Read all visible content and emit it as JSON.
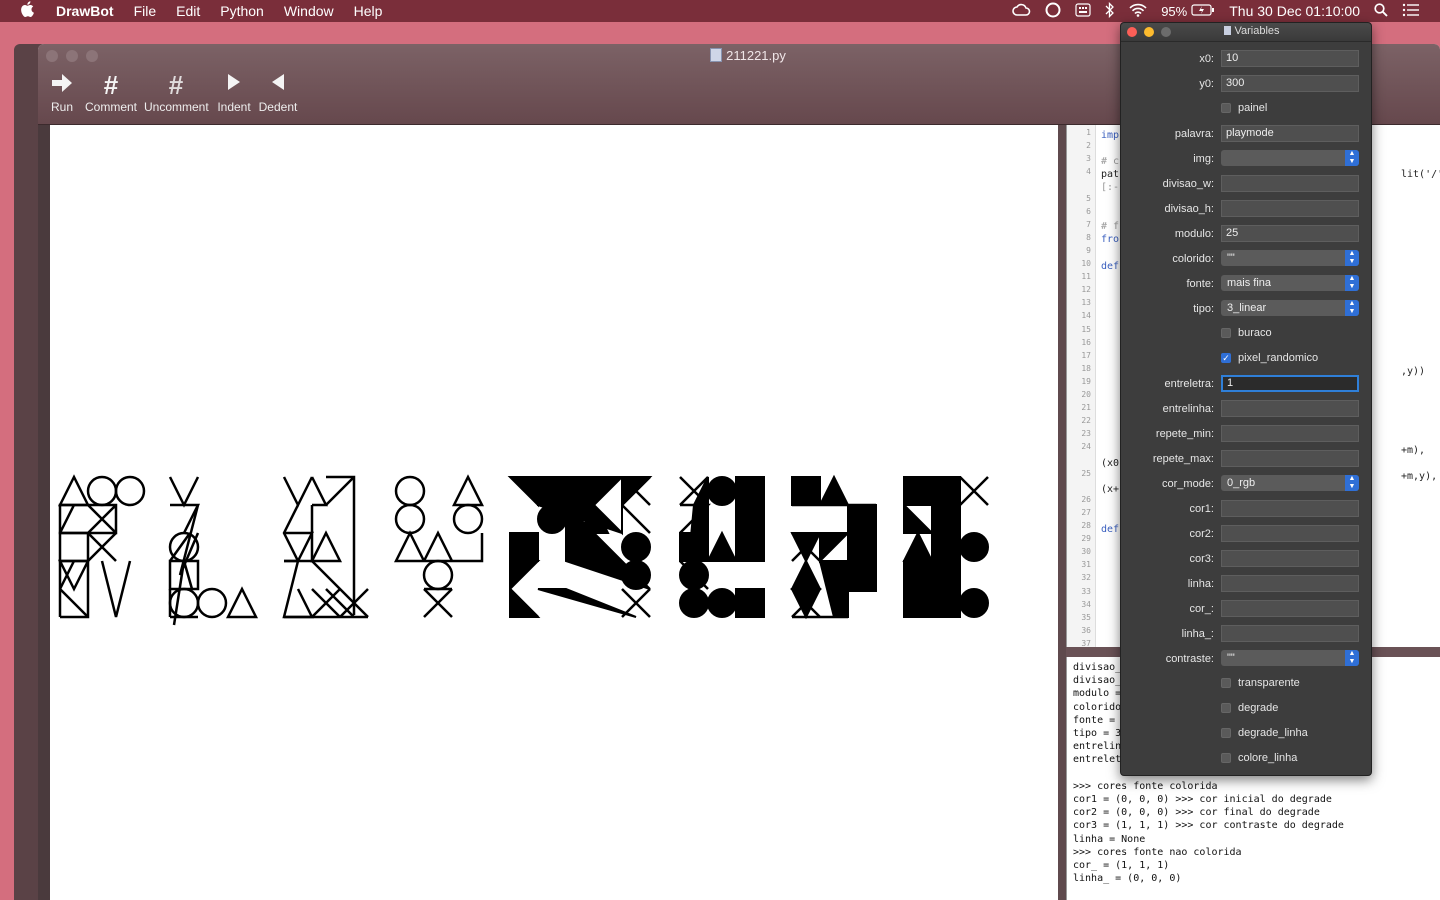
{
  "menubar": {
    "apple": "",
    "app_name": "DrawBot",
    "menus": [
      "File",
      "Edit",
      "Python",
      "Window",
      "Help"
    ],
    "status": {
      "battery": "95%",
      "clock": "Thu 30 Dec  01:10:00"
    }
  },
  "window": {
    "title": "211221.py",
    "toolbar": [
      {
        "label": "Run",
        "icon": "run-arrow-icon"
      },
      {
        "label": "Comment",
        "icon": "hash-icon"
      },
      {
        "label": "Uncomment",
        "icon": "uncomment-hash-icon"
      },
      {
        "label": "Indent",
        "icon": "indent-triangle-icon"
      },
      {
        "label": "Dedent",
        "icon": "dedent-triangle-icon"
      }
    ]
  },
  "editor": {
    "line_numbers": [
      "1",
      "2",
      "3",
      "4",
      "",
      "5",
      "6",
      "7",
      "8",
      "9",
      "10",
      "11",
      "12",
      "13",
      "14",
      "15",
      "16",
      "17",
      "18",
      "19",
      "20",
      "21",
      "22",
      "23",
      "24",
      "",
      "25",
      "",
      "26",
      "27",
      "28",
      "29",
      "30",
      "31",
      "32",
      "33",
      "34",
      "35",
      "36",
      "37"
    ],
    "snippets": {
      "l1": "imp",
      "l3": "# c",
      "l4a": "pat",
      "l4b": "[:-",
      "l4c": "lit('/')",
      "l7": "# f",
      "l8": "fro",
      "l10": "def",
      "l18": ",y))",
      "l24": "+m),",
      "l24b": "(x0",
      "l25": "+m,y),",
      "l25b": "(x+",
      "l28": "def"
    }
  },
  "output": {
    "lines": [
      "divisao_",
      "divisao_",
      "modulo =",
      "colorido",
      "fonte = ",
      "tipo = 3",
      "entrelin",
      "entrelet",
      "",
      ">>> cores fonte colorida",
      "cor1 = (0, 0, 0) >>> cor inicial do degrade",
      "cor2 = (0, 0, 0) >>> cor final do degrade",
      "cor3 = (1, 1, 1) >>> cor contraste do degrade",
      "linha = None",
      ">>> cores fonte nao colorida",
      "cor_ = (1, 1, 1)",
      "linha_ = (0, 0, 0)"
    ]
  },
  "variables_panel": {
    "title": "Variables",
    "rows": [
      {
        "kind": "field",
        "label": "x0:",
        "value": "10"
      },
      {
        "kind": "field",
        "label": "y0:",
        "value": "300"
      },
      {
        "kind": "checkbox",
        "label": "painel",
        "checked": false
      },
      {
        "kind": "field",
        "label": "palavra:",
        "value": "playmode"
      },
      {
        "kind": "popup",
        "label": "img:",
        "value": ""
      },
      {
        "kind": "field",
        "label": "divisao_w:",
        "value": ""
      },
      {
        "kind": "field",
        "label": "divisao_h:",
        "value": ""
      },
      {
        "kind": "field",
        "label": "modulo:",
        "value": "25"
      },
      {
        "kind": "popup",
        "label": "colorido:",
        "value": "\"\""
      },
      {
        "kind": "popup",
        "label": "fonte:",
        "value": "mais fina"
      },
      {
        "kind": "popup",
        "label": "tipo:",
        "value": "3_linear"
      },
      {
        "kind": "checkbox",
        "label": "buraco",
        "checked": false
      },
      {
        "kind": "checkbox",
        "label": "pixel_randomico",
        "checked": true
      },
      {
        "kind": "field",
        "label": "entreletra:",
        "value": "1",
        "focused": true
      },
      {
        "kind": "field",
        "label": "entrelinha:",
        "value": ""
      },
      {
        "kind": "field",
        "label": "repete_min:",
        "value": ""
      },
      {
        "kind": "field",
        "label": "repete_max:",
        "value": ""
      },
      {
        "kind": "popup",
        "label": "cor_mode:",
        "value": "0_rgb"
      },
      {
        "kind": "field",
        "label": "cor1:",
        "value": ""
      },
      {
        "kind": "field",
        "label": "cor2:",
        "value": ""
      },
      {
        "kind": "field",
        "label": "cor3:",
        "value": ""
      },
      {
        "kind": "field",
        "label": "linha:",
        "value": ""
      },
      {
        "kind": "field",
        "label": "cor_:",
        "value": ""
      },
      {
        "kind": "field",
        "label": "linha_:",
        "value": ""
      },
      {
        "kind": "popup",
        "label": "contraste:",
        "value": "\"\""
      },
      {
        "kind": "checkbox",
        "label": "transparente",
        "checked": false
      },
      {
        "kind": "checkbox",
        "label": "degrade",
        "checked": false
      },
      {
        "kind": "checkbox",
        "label": "degrade_linha",
        "checked": false
      },
      {
        "kind": "checkbox",
        "label": "colore_linha",
        "checked": false
      }
    ]
  },
  "colors": {
    "desktop": "#d46e7e",
    "menubar": "#7a2e3a",
    "panel": "#3d3d3d",
    "accent": "#2f6fd6"
  }
}
